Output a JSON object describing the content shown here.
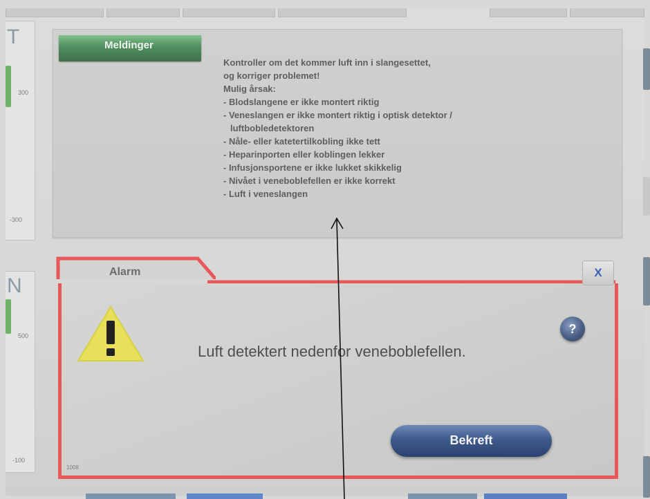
{
  "left_gauges": [
    {
      "letter": "T",
      "value_top": "300",
      "value_bottom": "-300"
    },
    {
      "letter": "N",
      "value_top": "500",
      "value_bottom": "-100"
    }
  ],
  "messages": {
    "tab_label": "Meldinger",
    "lines": [
      "Kontroller om det kommer luft inn i slangesettet,",
      "og korriger problemet!",
      "Mulig årsak:",
      "- Blodslangene er ikke montert riktig",
      "- Veneslangen er ikke montert riktig i optisk detektor /",
      "luftbobledetektoren",
      "- Nåle- eller katetertilkobling ikke tett",
      "- Heparinporten eller koblingen lekker",
      "- Infusjonsportene er ikke lukket skikkelig",
      "- Nivået i veneboblefellen er ikke korrekt",
      "- Luft i veneslangen"
    ]
  },
  "alarm": {
    "tab_label": "Alarm",
    "message": "Luft detektert nedenfor veneboblefellen.",
    "close_label": "X",
    "help_label": "?",
    "confirm_label": "Bekreft",
    "code": "1008",
    "border_color": "#e8575a"
  },
  "icons": {
    "warning": "warning-triangle-icon",
    "help": "question-icon",
    "close": "close-icon"
  }
}
